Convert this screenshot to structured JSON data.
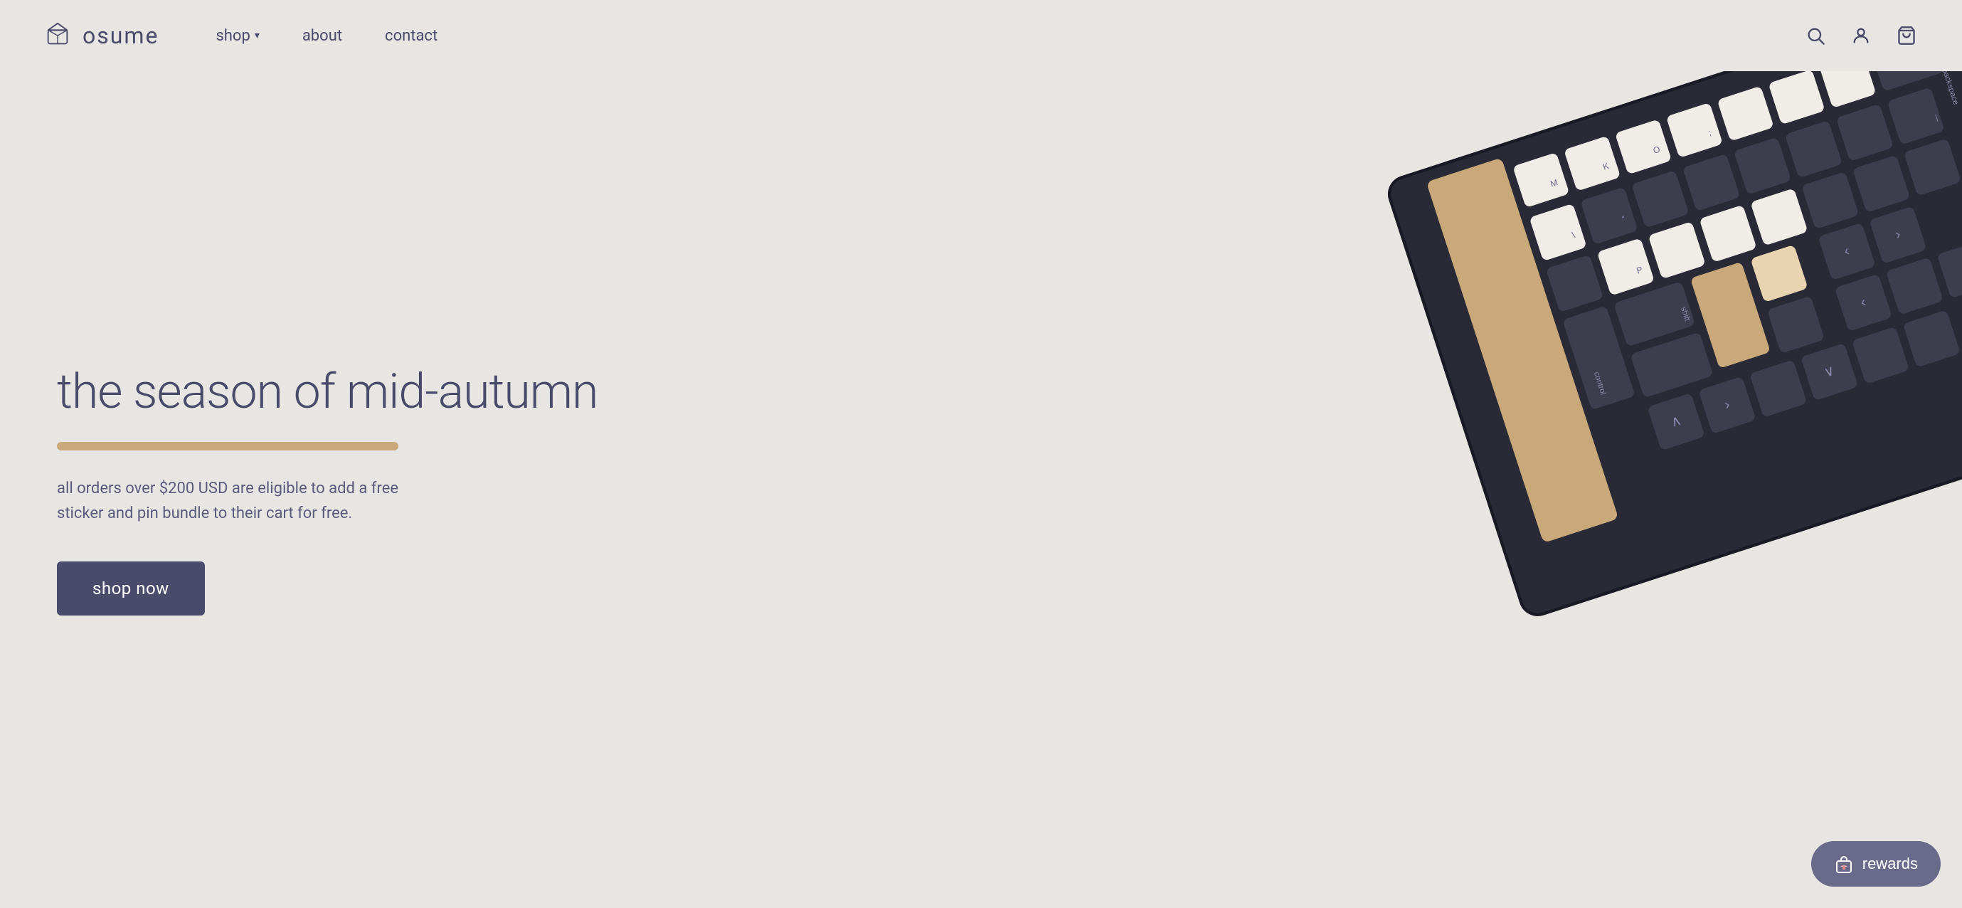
{
  "brand": {
    "name": "osume",
    "logo_alt": "osume logo"
  },
  "navbar": {
    "shop_label": "shop",
    "about_label": "about",
    "contact_label": "contact"
  },
  "hero": {
    "title": "the season of mid-autumn",
    "description": "all orders over $200 USD are eligible to add a free sticker and pin bundle to their cart for free.",
    "cta_label": "shop now"
  },
  "rewards": {
    "label": "rewards"
  },
  "icons": {
    "search": "search-icon",
    "account": "account-icon",
    "cart": "cart-icon",
    "rewards_bag": "rewards-bag-icon"
  },
  "colors": {
    "bg": "#e8e6e3",
    "navy": "#4a4a6a",
    "tan": "#c9a97a",
    "button_bg": "#4a4a6a",
    "rewards_bg": "#6a6a8a",
    "key_dark": "#3d3d4e",
    "key_light": "#f0ede8",
    "keyboard_body": "#2d2d3a"
  }
}
